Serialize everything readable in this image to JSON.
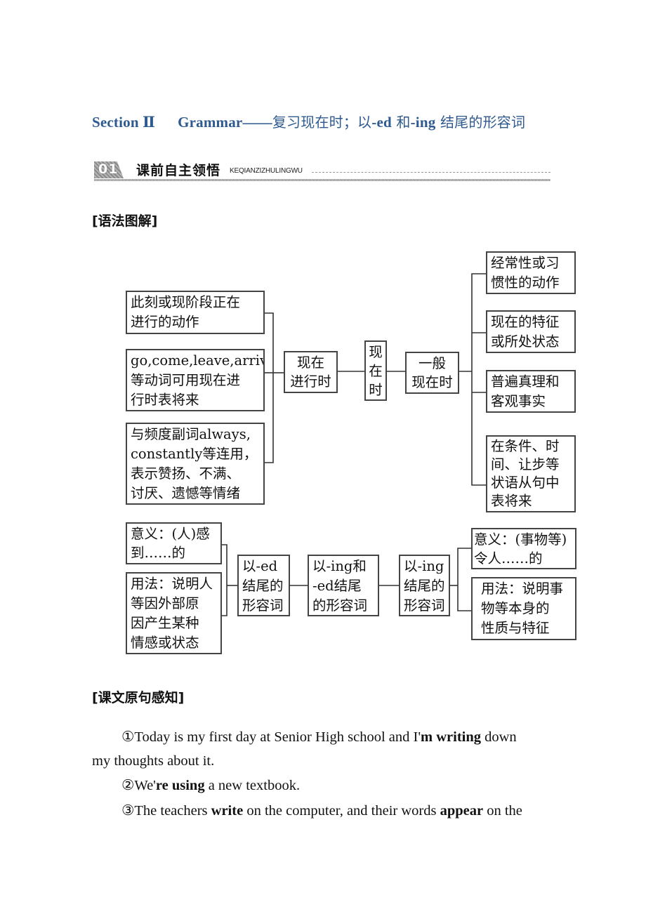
{
  "header": {
    "title_en": "Section Ⅱ",
    "title_grammar": "Grammar——",
    "title_cn_1": "复习现在时；以",
    "title_ed": "-ed",
    "title_cn_2": " 和",
    "title_ing": "-ing",
    "title_cn_3": " 结尾的形容词"
  },
  "banner": {
    "number": "01",
    "label": "课前自主领悟",
    "pinyin": "KEQIANZIZHULINGWU"
  },
  "section_grammar_diagram": {
    "heading": "[语法图解]",
    "present_continuous": {
      "center": [
        "现在",
        "进行时"
      ],
      "uses": [
        [
          "此刻或现阶段正在",
          "进行的动作"
        ],
        [
          "go,come,leave,arrive",
          "等动词可用现在进",
          "行时表将来"
        ],
        [
          "与频度副词always,",
          "constantly等连用，",
          "表示赞扬、不满、",
          "讨厌、遗憾等情绪"
        ]
      ]
    },
    "root": [
      "现",
      "在",
      "时"
    ],
    "simple_present": {
      "center": [
        "一般",
        "现在时"
      ],
      "uses": [
        [
          "经常性或习",
          "惯性的动作"
        ],
        [
          "现在的特征",
          "或所处状态"
        ],
        [
          "普遍真理和",
          "客观事实"
        ],
        [
          "在条件、时",
          "间、让步等",
          "状语从句中",
          "表将来"
        ]
      ]
    },
    "adjectives": {
      "ed": {
        "center": [
          "以-ed",
          "结尾的",
          "形容词"
        ],
        "meaning": [
          "意义：(人)感",
          "到……的"
        ],
        "usage": [
          "用法：说明人",
          "等因外部原",
          "因产生某种",
          "情感或状态"
        ]
      },
      "root": [
        "以-ing和",
        "-ed结尾",
        "的形容词"
      ],
      "ing": {
        "center": [
          "以-ing",
          "结尾的",
          "形容词"
        ],
        "meaning": [
          "意义：(事物等)",
          "令人……的"
        ],
        "usage": [
          "用法：说明事",
          "物等本身的",
          "性质与特征"
        ]
      }
    }
  },
  "section_text_sentences": {
    "heading": "[课文原句感知]",
    "sentences": [
      {
        "line1": [
          {
            "t": "①Today is my first day at Senior High school and I'",
            "b": false
          },
          {
            "t": "m writing",
            "b": true
          },
          {
            "t": " down",
            "b": false
          }
        ],
        "line2": "my thoughts about it."
      },
      {
        "line1": [
          {
            "t": "②We'",
            "b": false
          },
          {
            "t": "re using",
            "b": true
          },
          {
            "t": " a new textbook.",
            "b": false
          }
        ]
      },
      {
        "line1": [
          {
            "t": "③The teachers ",
            "b": false
          },
          {
            "t": "write",
            "b": true
          },
          {
            "t": " on the computer, and their words ",
            "b": false
          },
          {
            "t": "appear",
            "b": true
          },
          {
            "t": " on the",
            "b": false
          }
        ]
      }
    ]
  },
  "colors": {
    "title_blue": "#2f5a8f",
    "box_border": "#444444",
    "text": "#111111"
  }
}
